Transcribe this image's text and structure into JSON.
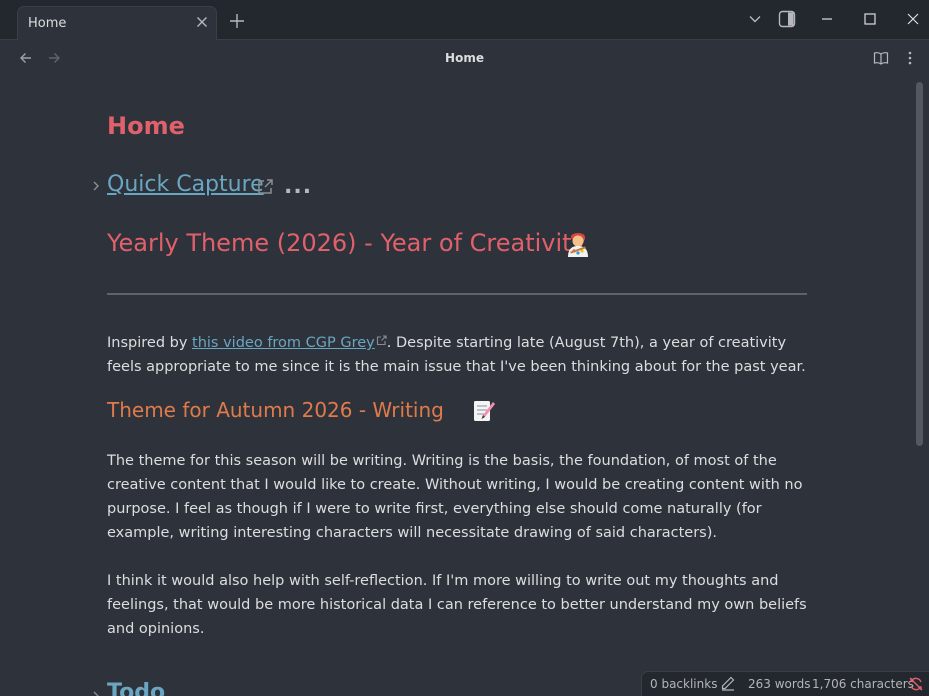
{
  "tabs": [
    {
      "title": "Home"
    }
  ],
  "view": {
    "title": "Home"
  },
  "note": {
    "title": "Home",
    "quick_capture": "Quick Capture",
    "more": "...",
    "yearly_theme": "Yearly Theme (2026) - Year of Creativity",
    "intro_prefix": "Inspired by ",
    "intro_link": "this video from CGP Grey",
    "intro_suffix": ". Despite starting late (August 7th), a year of creativity feels appropriate to me since it is the main issue that I've been thinking about for the past year.",
    "autumn_theme": "Theme for Autumn 2026 - Writing",
    "para2": "The theme for this season will be writing. Writing is the basis, the foundation, of most of the creative content that I would like to create. Without writing, I would be creating content with no purpose. I feel as though if I were to write first, everything else should come naturally (for example, writing interesting characters will necessitate drawing of said characters).",
    "para3": "I think it would also help with self-reflection. If I'm more willing to write out my thoughts and feelings, that would be more historical data I can reference to better understand my own beliefs and opinions.",
    "next_heading": "Todo"
  },
  "status": {
    "backlinks": "0 backlinks",
    "words": "263 words",
    "characters": "1,706 characters"
  },
  "icons": {
    "close": "close-icon",
    "new_tab": "plus-icon",
    "emoji1": "artist-emoji",
    "emoji2": "memo-emoji"
  },
  "colors": {
    "h1": "#e0606b",
    "h3": "#e07a4a",
    "link": "#6aa6c2",
    "background": "#2e333b"
  }
}
